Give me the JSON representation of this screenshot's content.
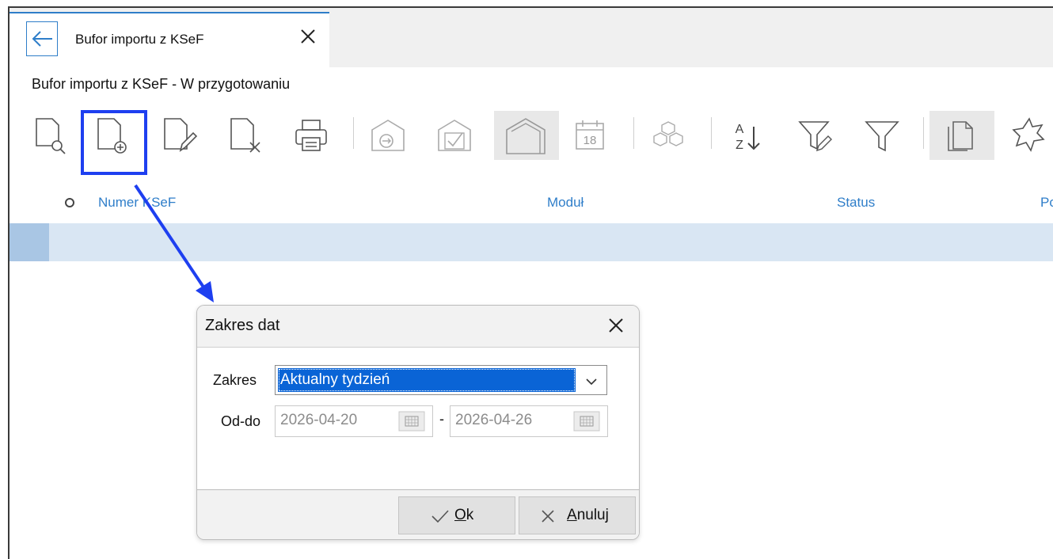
{
  "tab": {
    "title": "Bufor importu z KSeF"
  },
  "subtitle": "Bufor importu z KSeF - W przygotowaniu",
  "toolbar": {
    "items": [
      "preview-doc-icon",
      "add-doc-icon",
      "edit-doc-icon",
      "delete-doc-icon",
      "print-icon",
      "import-icon",
      "approve-icon",
      "house-icon",
      "calendar-icon",
      "modules-icon",
      "sort-az-icon",
      "filter-edit-icon",
      "filter-icon",
      "copy-icon",
      "burst-icon"
    ],
    "calendar_day": "18",
    "sort_top": "A",
    "sort_bottom": "Z"
  },
  "columns": [
    "Numer KSeF",
    "Moduł",
    "Status",
    "Po"
  ],
  "dialog": {
    "title": "Zakres dat",
    "range_label": "Zakres",
    "range_value": "Aktualny tydzień",
    "dates_label": "Od-do",
    "date_from": "2026-04-20",
    "date_separator": "-",
    "date_to": "2026-04-26",
    "ok_label_u": "O",
    "ok_label_rest": "k",
    "cancel_label_u": "A",
    "cancel_label_rest": "nuluj"
  },
  "colors": {
    "accent": "#2f7ec9",
    "highlight": "#1e3ff0",
    "selection": "#0a64d6"
  }
}
